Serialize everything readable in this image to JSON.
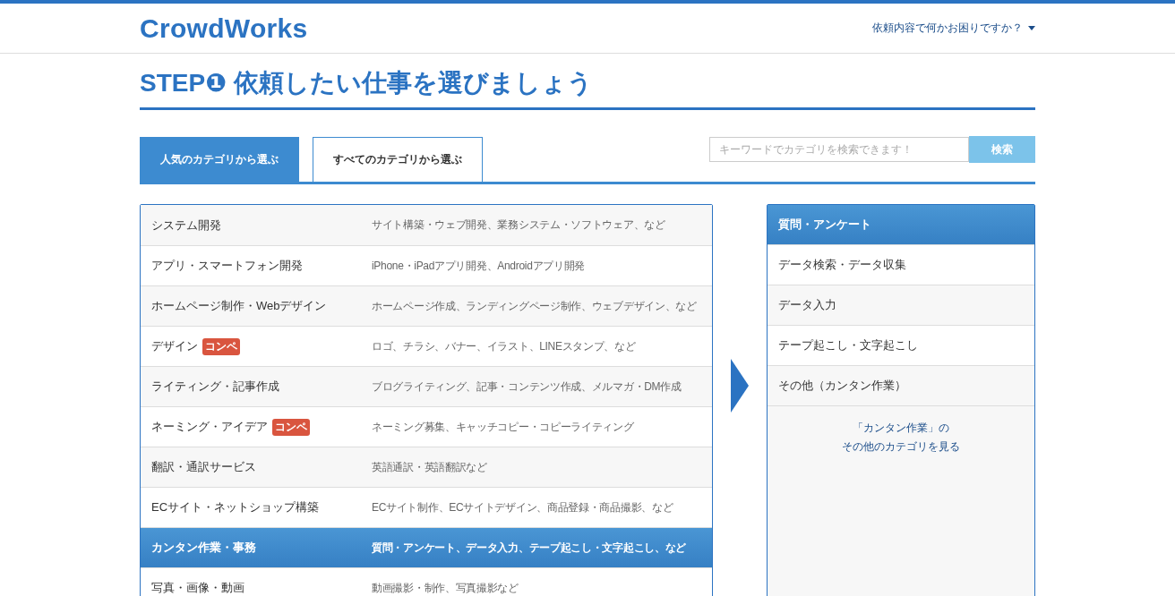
{
  "header": {
    "logo": "CrowdWorks",
    "help_menu": "依頼内容で何かお困りですか？"
  },
  "title": "STEP❶ 依頼したい仕事を選びましょう",
  "tabs": [
    {
      "label": "人気のカテゴリから選ぶ",
      "selected": true
    },
    {
      "label": "すべてのカテゴリから選ぶ",
      "selected": false
    }
  ],
  "search": {
    "placeholder": "キーワードでカテゴリを検索できます！",
    "button": "検索"
  },
  "categories": [
    {
      "name": "システム開発",
      "description": "サイト構築・ウェブ開発、業務システム・ソフトウェア、など",
      "selected": false
    },
    {
      "name": "アプリ・スマートフォン開発",
      "description": "iPhone・iPadアプリ開発、Androidアプリ開発",
      "selected": false
    },
    {
      "name": "ホームページ制作・Webデザイン",
      "description": "ホームページ作成、ランディングページ制作、ウェブデザイン、など",
      "selected": false
    },
    {
      "name": "デザイン",
      "badge": "コンペ",
      "description": "ロゴ、チラシ、バナー、イラスト、LINEスタンプ、など",
      "selected": false
    },
    {
      "name": "ライティング・記事作成",
      "description": "ブログライティング、記事・コンテンツ作成、メルマガ・DM作成",
      "selected": false
    },
    {
      "name": "ネーミング・アイデア",
      "badge": "コンペ",
      "description": "ネーミング募集、キャッチコピー・コピーライティング",
      "selected": false
    },
    {
      "name": "翻訳・通訳サービス",
      "description": "英語通訳・英語翻訳など",
      "selected": false
    },
    {
      "name": "ECサイト・ネットショップ構築",
      "description": "ECサイト制作、ECサイトデザイン、商品登録・商品撮影、など",
      "selected": false
    },
    {
      "name": "カンタン作業・事務",
      "description": "質問・アンケート、データ入力、テープ起こし・文字起こし、など",
      "selected": true
    },
    {
      "name": "写真・画像・動画",
      "description": "動画撮影・制作、写真撮影など",
      "selected": false
    }
  ],
  "subcategories": [
    {
      "label": "質問・アンケート",
      "selected": true
    },
    {
      "label": "データ検索・データ収集",
      "selected": false
    },
    {
      "label": "データ入力",
      "selected": false
    },
    {
      "label": "テープ起こし・文字起こし",
      "selected": false
    },
    {
      "label": "その他（カンタン作業）",
      "selected": false
    }
  ],
  "more_link": [
    "「カンタン作業」の",
    "その他のカテゴリを見る"
  ]
}
